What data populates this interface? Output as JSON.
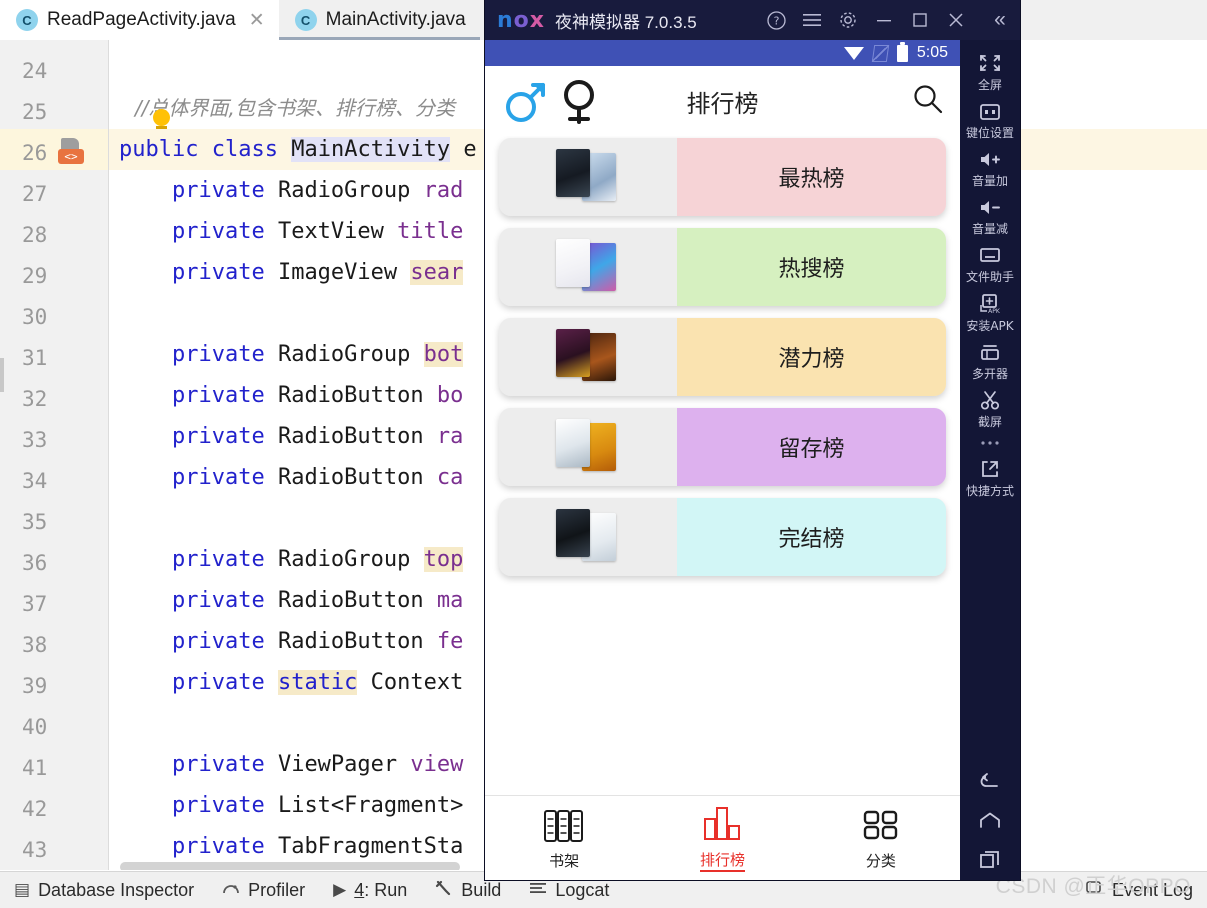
{
  "ide": {
    "tabs": [
      {
        "label": "ReadPageActivity.java",
        "icon": "java-class-icon",
        "badge": "C",
        "closable": true,
        "active": false
      },
      {
        "label": "MainActivity.java",
        "icon": "java-class-icon",
        "badge": "C",
        "closable": false,
        "active": true
      }
    ],
    "code_lines": [
      {
        "num": "24",
        "text": ""
      },
      {
        "num": "25",
        "text": "//总体界面,包含书架、排行榜、分类"
      },
      {
        "num": "26",
        "text": "public class MainActivity e"
      },
      {
        "num": "27",
        "text": "    private RadioGroup rad"
      },
      {
        "num": "28",
        "text": "    private TextView title"
      },
      {
        "num": "29",
        "text": "    private ImageView sear"
      },
      {
        "num": "30",
        "text": ""
      },
      {
        "num": "31",
        "text": "    private RadioGroup bot"
      },
      {
        "num": "32",
        "text": "    private RadioButton bo"
      },
      {
        "num": "33",
        "text": "    private RadioButton ra"
      },
      {
        "num": "34",
        "text": "    private RadioButton ca"
      },
      {
        "num": "35",
        "text": ""
      },
      {
        "num": "36",
        "text": "    private RadioGroup top"
      },
      {
        "num": "37",
        "text": "    private RadioButton ma"
      },
      {
        "num": "38",
        "text": "    private RadioButton fe"
      },
      {
        "num": "39",
        "text": "    private static Context"
      },
      {
        "num": "40",
        "text": ""
      },
      {
        "num": "41",
        "text": "    private ViewPager view"
      },
      {
        "num": "42",
        "text": "    private List<Fragment>"
      },
      {
        "num": "43",
        "text": "    private TabFragmentSta"
      }
    ],
    "status_bar": {
      "items": [
        {
          "label": "Database Inspector",
          "icon": "database-icon"
        },
        {
          "label": "Profiler",
          "icon": "profiler-icon"
        },
        {
          "label": "4: Run",
          "icon": "run-icon",
          "mnemonic": "4"
        },
        {
          "label": "Build",
          "icon": "build-hammer-icon"
        },
        {
          "label": "Logcat",
          "icon": "logcat-icon"
        }
      ],
      "right": {
        "label": "Event Log",
        "icon": "event-log-icon"
      }
    },
    "watermark": "CSDN @正华OPPO"
  },
  "nox": {
    "logo": {
      "n": "n",
      "o": "o",
      "x": "x"
    },
    "title": "夜神模拟器 7.0.3.5",
    "window_buttons": [
      {
        "name": "help-icon",
        "glyph": "?"
      },
      {
        "name": "menu-icon",
        "glyph": "☰"
      },
      {
        "name": "gear-icon",
        "glyph": "⚙"
      },
      {
        "name": "minimize-icon",
        "glyph": "—"
      },
      {
        "name": "maximize-icon",
        "glyph": "□"
      },
      {
        "name": "close-icon",
        "glyph": "✕"
      }
    ],
    "collapse_glyph": "«",
    "tools": [
      {
        "label": "全屏",
        "icon": "fullscreen-icon"
      },
      {
        "label": "键位设置",
        "icon": "keymap-icon"
      },
      {
        "label": "音量加",
        "icon": "volume-up-icon"
      },
      {
        "label": "音量减",
        "icon": "volume-down-icon"
      },
      {
        "label": "文件助手",
        "icon": "file-assistant-icon"
      },
      {
        "label": "安装APK",
        "icon": "install-apk-icon"
      },
      {
        "label": "多开器",
        "icon": "multi-instance-icon"
      },
      {
        "label": "截屏",
        "icon": "screenshot-scissors-icon"
      },
      {
        "label": "",
        "icon": "more-dots-icon"
      },
      {
        "label": "快捷方式",
        "icon": "shortcut-icon"
      }
    ],
    "nav_buttons": [
      {
        "name": "android-back-icon"
      },
      {
        "name": "android-home-icon"
      },
      {
        "name": "android-recents-icon"
      }
    ]
  },
  "android": {
    "status": {
      "time": "5:05",
      "icons": [
        "wifi-icon",
        "signal-icon",
        "battery-icon"
      ]
    },
    "header": {
      "title": "排行榜",
      "male_icon": "male-gender-icon",
      "female_icon": "female-gender-icon",
      "search_icon": "search-icon"
    },
    "rank_items": [
      {
        "label": "最热榜",
        "color": "#f6d3d6",
        "cover_front": "#1e2430",
        "cover_back": "#d9e4f2"
      },
      {
        "label": "热搜榜",
        "color": "#d6f0c0",
        "cover_front": "#f4f4f4",
        "cover_back": "#5a3f8c"
      },
      {
        "label": "潜力榜",
        "color": "#fae3b0",
        "cover_front": "#3a1a30",
        "cover_back": "#5e2a18"
      },
      {
        "label": "留存榜",
        "color": "#ddb1ee",
        "cover_front": "#eef1f3",
        "cover_back": "#e8a820"
      },
      {
        "label": "完结榜",
        "color": "#d2f6f6",
        "cover_front": "#1c1c20",
        "cover_back": "#eceff2"
      }
    ],
    "bottom_tabs": [
      {
        "label": "书架",
        "icon": "bookshelf-icon",
        "active": false
      },
      {
        "label": "排行榜",
        "icon": "ranking-bars-icon",
        "active": true
      },
      {
        "label": "分类",
        "icon": "category-grid-icon",
        "active": false
      }
    ],
    "accent_color": "#e8302a"
  }
}
